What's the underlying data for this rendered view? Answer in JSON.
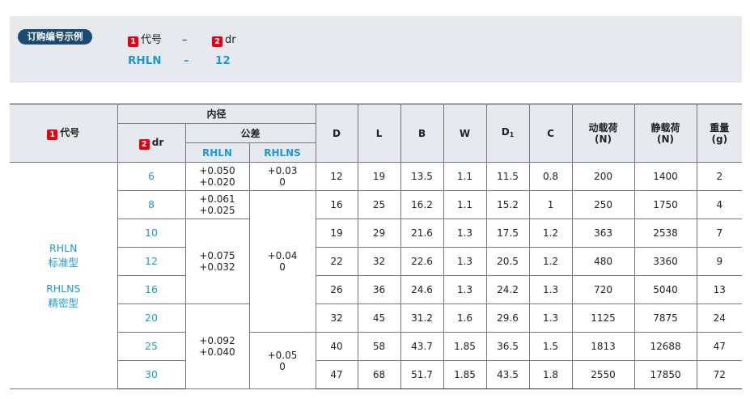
{
  "order_example": {
    "title": "订购编号示例",
    "label1_num": "1",
    "label1": "代号",
    "dash": "–",
    "label2_num": "2",
    "label2": "dr",
    "value1": "RHLN",
    "value2": "12"
  },
  "table": {
    "headers": {
      "code_num": "1",
      "code": "代号",
      "inner_diameter": "内径",
      "dr_num": "2",
      "dr": "dr",
      "tolerance": "公差",
      "tol_rhln": "RHLN",
      "tol_rhlns": "RHLNS",
      "D": "D",
      "L": "L",
      "B": "B",
      "W": "W",
      "D1": "D",
      "D1_sub": "1",
      "C": "C",
      "dyn_load": "动载荷",
      "dyn_unit": "(N)",
      "stat_load": "静载荷",
      "stat_unit": "(N)",
      "weight": "重量",
      "weight_unit": "(g)"
    },
    "series": {
      "s1": "RHLN",
      "s1_desc": "标准型",
      "s2": "RHLNS",
      "s2_desc": "精密型"
    },
    "tolerances": {
      "rhln_a_upper": "+0.050",
      "rhln_a_lower": "+0.020",
      "rhln_b_upper": "+0.061",
      "rhln_b_lower": "+0.025",
      "rhln_c_upper": "+0.075",
      "rhln_c_lower": "+0.032",
      "rhln_d_upper": "+0.092",
      "rhln_d_lower": "+0.040",
      "rhlns_a_upper": "+0.03",
      "rhlns_a_lower": "0",
      "rhlns_b_upper": "+0.04",
      "rhlns_b_lower": "0",
      "rhlns_c_upper": "+0.05",
      "rhlns_c_lower": "0"
    },
    "rows": [
      {
        "dr": "6",
        "D": "12",
        "L": "19",
        "B": "13.5",
        "W": "1.1",
        "D1": "11.5",
        "C": "0.8",
        "dyn": "200",
        "stat": "1400",
        "weight": "2"
      },
      {
        "dr": "8",
        "D": "16",
        "L": "25",
        "B": "16.2",
        "W": "1.1",
        "D1": "15.2",
        "C": "1",
        "dyn": "250",
        "stat": "1750",
        "weight": "4"
      },
      {
        "dr": "10",
        "D": "19",
        "L": "29",
        "B": "21.6",
        "W": "1.3",
        "D1": "17.5",
        "C": "1.2",
        "dyn": "363",
        "stat": "2538",
        "weight": "7"
      },
      {
        "dr": "12",
        "D": "22",
        "L": "32",
        "B": "22.6",
        "W": "1.3",
        "D1": "20.5",
        "C": "1.2",
        "dyn": "480",
        "stat": "3360",
        "weight": "9"
      },
      {
        "dr": "16",
        "D": "26",
        "L": "36",
        "B": "24.6",
        "W": "1.3",
        "D1": "24.2",
        "C": "1.3",
        "dyn": "720",
        "stat": "5040",
        "weight": "13"
      },
      {
        "dr": "20",
        "D": "32",
        "L": "45",
        "B": "31.2",
        "W": "1.6",
        "D1": "29.6",
        "C": "1.3",
        "dyn": "1125",
        "stat": "7875",
        "weight": "24"
      },
      {
        "dr": "25",
        "D": "40",
        "L": "58",
        "B": "43.7",
        "W": "1.85",
        "D1": "36.5",
        "C": "1.5",
        "dyn": "1813",
        "stat": "12688",
        "weight": "47"
      },
      {
        "dr": "30",
        "D": "47",
        "L": "68",
        "B": "51.7",
        "W": "1.85",
        "D1": "43.5",
        "C": "1.8",
        "dyn": "2550",
        "stat": "17850",
        "weight": "72"
      }
    ]
  }
}
